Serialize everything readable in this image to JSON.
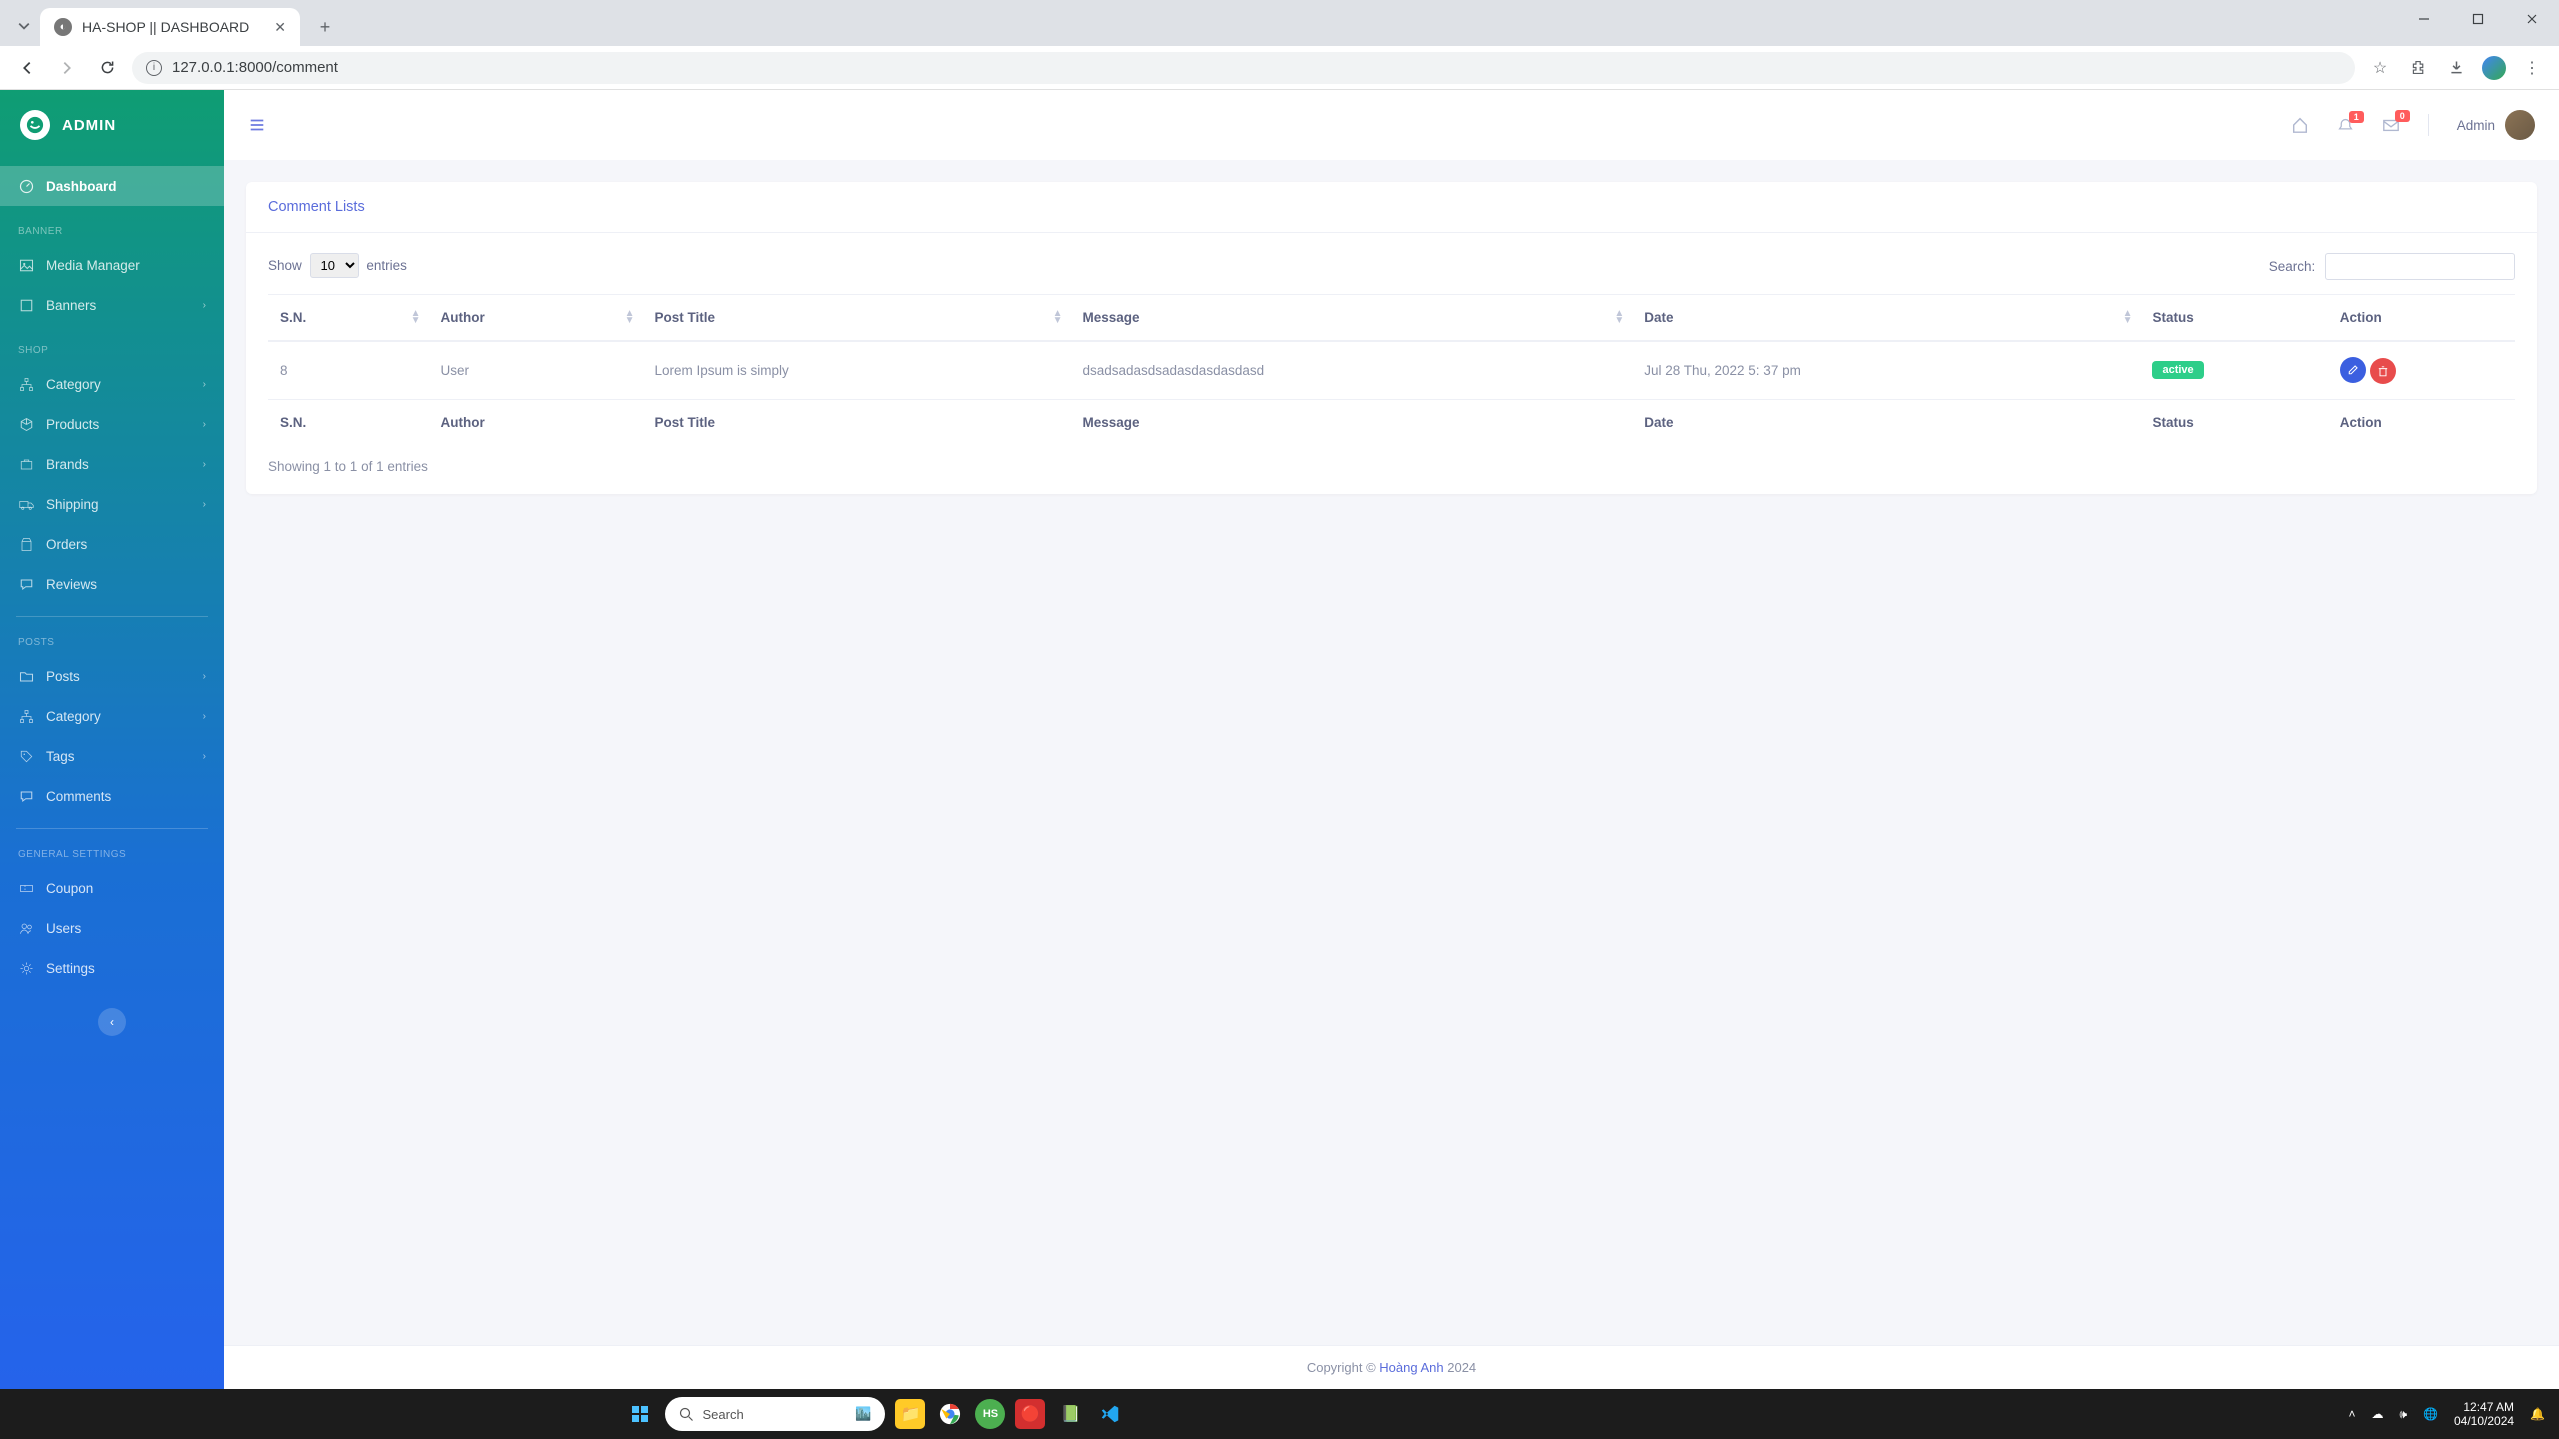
{
  "browser": {
    "tab_title": "HA-SHOP || DASHBOARD",
    "url": "127.0.0.1:8000/comment"
  },
  "sidebar": {
    "brand": "ADMIN",
    "sections": [
      {
        "items": [
          {
            "label": "Dashboard",
            "icon": "dashboard",
            "active": true
          }
        ]
      },
      {
        "heading": "BANNER",
        "items": [
          {
            "label": "Media Manager",
            "icon": "image"
          },
          {
            "label": "Banners",
            "icon": "layers",
            "sub": true
          }
        ]
      },
      {
        "heading": "SHOP",
        "items": [
          {
            "label": "Category",
            "icon": "sitemap",
            "sub": true
          },
          {
            "label": "Products",
            "icon": "cube",
            "sub": true
          },
          {
            "label": "Brands",
            "icon": "brand",
            "sub": true
          },
          {
            "label": "Shipping",
            "icon": "truck",
            "sub": true
          },
          {
            "label": "Orders",
            "icon": "orders"
          },
          {
            "label": "Reviews",
            "icon": "comments"
          }
        ],
        "divider": true
      },
      {
        "heading": "POSTS",
        "items": [
          {
            "label": "Posts",
            "icon": "folder",
            "sub": true
          },
          {
            "label": "Category",
            "icon": "sitemap",
            "sub": true
          },
          {
            "label": "Tags",
            "icon": "tags",
            "sub": true
          },
          {
            "label": "Comments",
            "icon": "comments"
          }
        ],
        "divider": true
      },
      {
        "heading": "GENERAL SETTINGS",
        "items": [
          {
            "label": "Coupon",
            "icon": "coupon"
          },
          {
            "label": "Users",
            "icon": "users"
          },
          {
            "label": "Settings",
            "icon": "gear"
          }
        ]
      }
    ]
  },
  "topbar": {
    "notif_badge": "1",
    "mail_badge": "0",
    "user_name": "Admin"
  },
  "card": {
    "title": "Comment Lists"
  },
  "datatable": {
    "show_label": "Show",
    "entries_label": "entries",
    "page_size": "10",
    "search_label": "Search:",
    "columns": [
      "S.N.",
      "Author",
      "Post Title",
      "Message",
      "Date",
      "Status",
      "Action"
    ],
    "rows": [
      {
        "sn": "8",
        "author": "User",
        "title": "Lorem Ipsum is simply",
        "message": "dsadsadasdsadasdasdasdasd",
        "date": "Jul 28 Thu, 2022 5: 37 pm",
        "status": "active"
      }
    ],
    "info": "Showing 1 to 1 of 1 entries"
  },
  "footer": {
    "prefix": "Copyright © ",
    "link": "Hoàng Anh",
    "suffix": " 2024"
  },
  "taskbar": {
    "search_placeholder": "Search",
    "time": "12:47 AM",
    "date": "04/10/2024"
  }
}
